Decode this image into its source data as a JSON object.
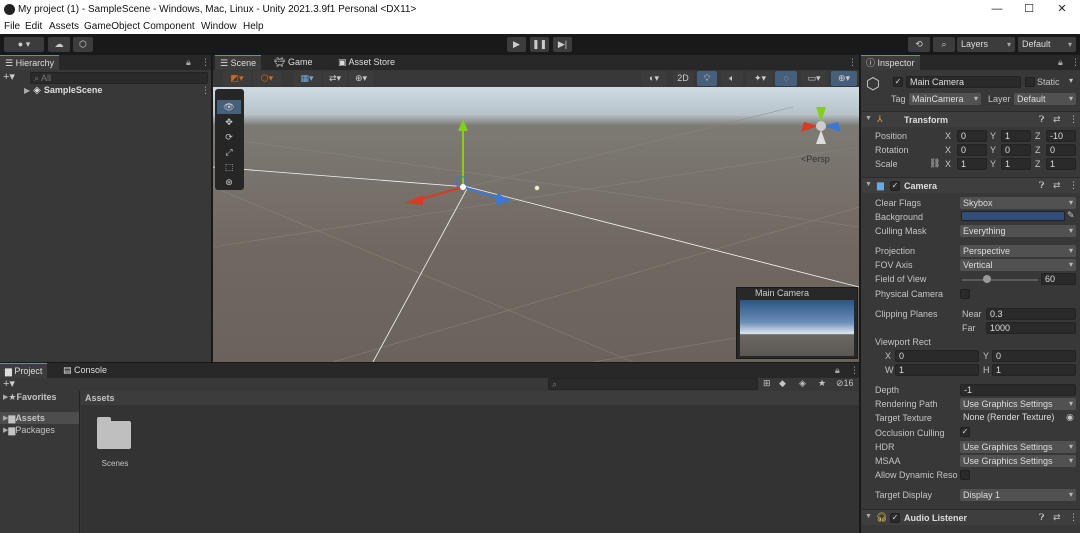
{
  "window": {
    "title": "My project (1) - SampleScene - Windows, Mac, Linux - Unity 2021.3.9f1 Personal <DX11>",
    "minimize": "—",
    "maximize": "☐",
    "close": "✕"
  },
  "menu": [
    "File",
    "Edit",
    "Assets",
    "GameObject",
    "Component",
    "Window",
    "Help"
  ],
  "toolbar": {
    "layers": "Layers",
    "layout": "Default"
  },
  "hierarchy": {
    "tab": "Hierarchy",
    "search_placeholder": "All",
    "scene": "SampleScene"
  },
  "scene_view": {
    "tabs": [
      "Scene",
      "Game",
      "Asset Store"
    ],
    "persp_label": "<Persp",
    "mode_2d": "2D",
    "camera_preview_title": "Main Camera"
  },
  "project": {
    "tabs": [
      "Project",
      "Console"
    ],
    "favorites": "Favorites",
    "tree": [
      "Assets",
      "Packages"
    ],
    "breadcrumb": "Assets",
    "items": [
      "Scenes"
    ],
    "hidden_count": "16"
  },
  "inspector": {
    "tab": "Inspector",
    "object_name": "Main Camera",
    "static_label": "Static",
    "tag_label": "Tag",
    "tag_value": "MainCamera",
    "layer_label": "Layer",
    "layer_value": "Default",
    "transform": {
      "title": "Transform",
      "rows": [
        {
          "label": "Position",
          "x": "0",
          "y": "1",
          "z": "-10"
        },
        {
          "label": "Rotation",
          "x": "0",
          "y": "0",
          "z": "0"
        },
        {
          "label": "Scale",
          "x": "1",
          "y": "1",
          "z": "1"
        }
      ]
    },
    "camera": {
      "title": "Camera",
      "clear_flags": {
        "label": "Clear Flags",
        "value": "Skybox"
      },
      "background": {
        "label": "Background",
        "color": "#314D79"
      },
      "culling_mask": {
        "label": "Culling Mask",
        "value": "Everything"
      },
      "projection": {
        "label": "Projection",
        "value": "Perspective"
      },
      "fov_axis": {
        "label": "FOV Axis",
        "value": "Vertical"
      },
      "field_of_view": {
        "label": "Field of View",
        "value": "60",
        "slider_fraction": 0.33
      },
      "physical_camera": {
        "label": "Physical Camera"
      },
      "clipping_planes": {
        "label": "Clipping Planes",
        "near_label": "Near",
        "near": "0.3",
        "far_label": "Far",
        "far": "1000"
      },
      "viewport_rect": {
        "label": "Viewport Rect",
        "x": "0",
        "y": "0",
        "w": "1",
        "h": "1"
      },
      "depth": {
        "label": "Depth",
        "value": "-1"
      },
      "rendering_path": {
        "label": "Rendering Path",
        "value": "Use Graphics Settings"
      },
      "target_texture": {
        "label": "Target Texture",
        "value": "None (Render Texture)"
      },
      "occlusion_culling": {
        "label": "Occlusion Culling"
      },
      "hdr": {
        "label": "HDR",
        "value": "Use Graphics Settings"
      },
      "msaa": {
        "label": "MSAA",
        "value": "Use Graphics Settings"
      },
      "allow_dynamic_reso": {
        "label": "Allow Dynamic Reso"
      },
      "target_display": {
        "label": "Target Display",
        "value": "Display 1"
      }
    },
    "audio_listener": {
      "title": "Audio Listener"
    }
  },
  "axis_letters": {
    "x": "X",
    "y": "Y",
    "z": "Z",
    "w": "W",
    "h": "H"
  }
}
